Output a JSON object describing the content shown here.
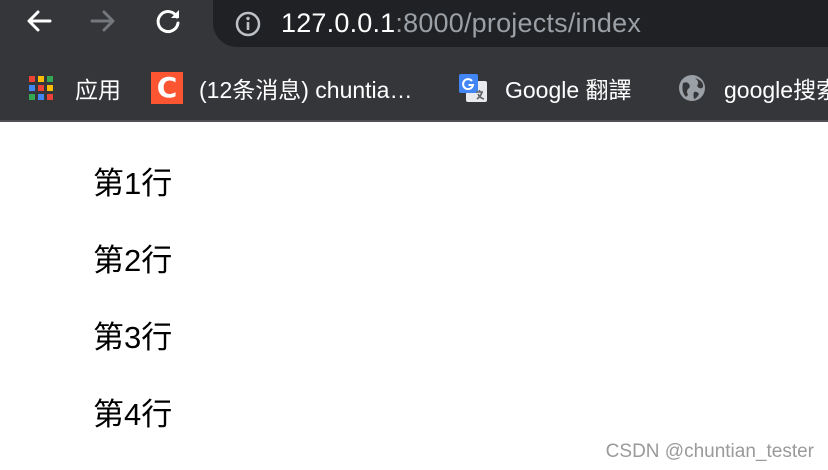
{
  "toolbar": {
    "back_icon": "arrow-left-icon",
    "forward_icon": "arrow-right-icon",
    "reload_icon": "reload-icon",
    "info_icon": "info-icon",
    "url_host": "127.0.0.1",
    "url_path": ":8000/projects/index"
  },
  "bookmarks": {
    "items": [
      {
        "label": "应用",
        "icon": "apps-grid-icon"
      },
      {
        "label": "(12条消息) chuntia…",
        "icon": "csdn-icon"
      },
      {
        "label": "Google 翻譯",
        "icon": "google-translate-icon"
      },
      {
        "label": "google搜索",
        "icon": "globe-icon"
      }
    ],
    "csdn_logo_letter": "C"
  },
  "page": {
    "rows": [
      "第1行",
      "第2行",
      "第3行",
      "第4行"
    ]
  },
  "watermark": "CSDN @chuntian_tester",
  "colors": {
    "toolbar_bg": "#35363a",
    "omnibox_bg": "#202124",
    "csdn_orange": "#fc5531"
  }
}
